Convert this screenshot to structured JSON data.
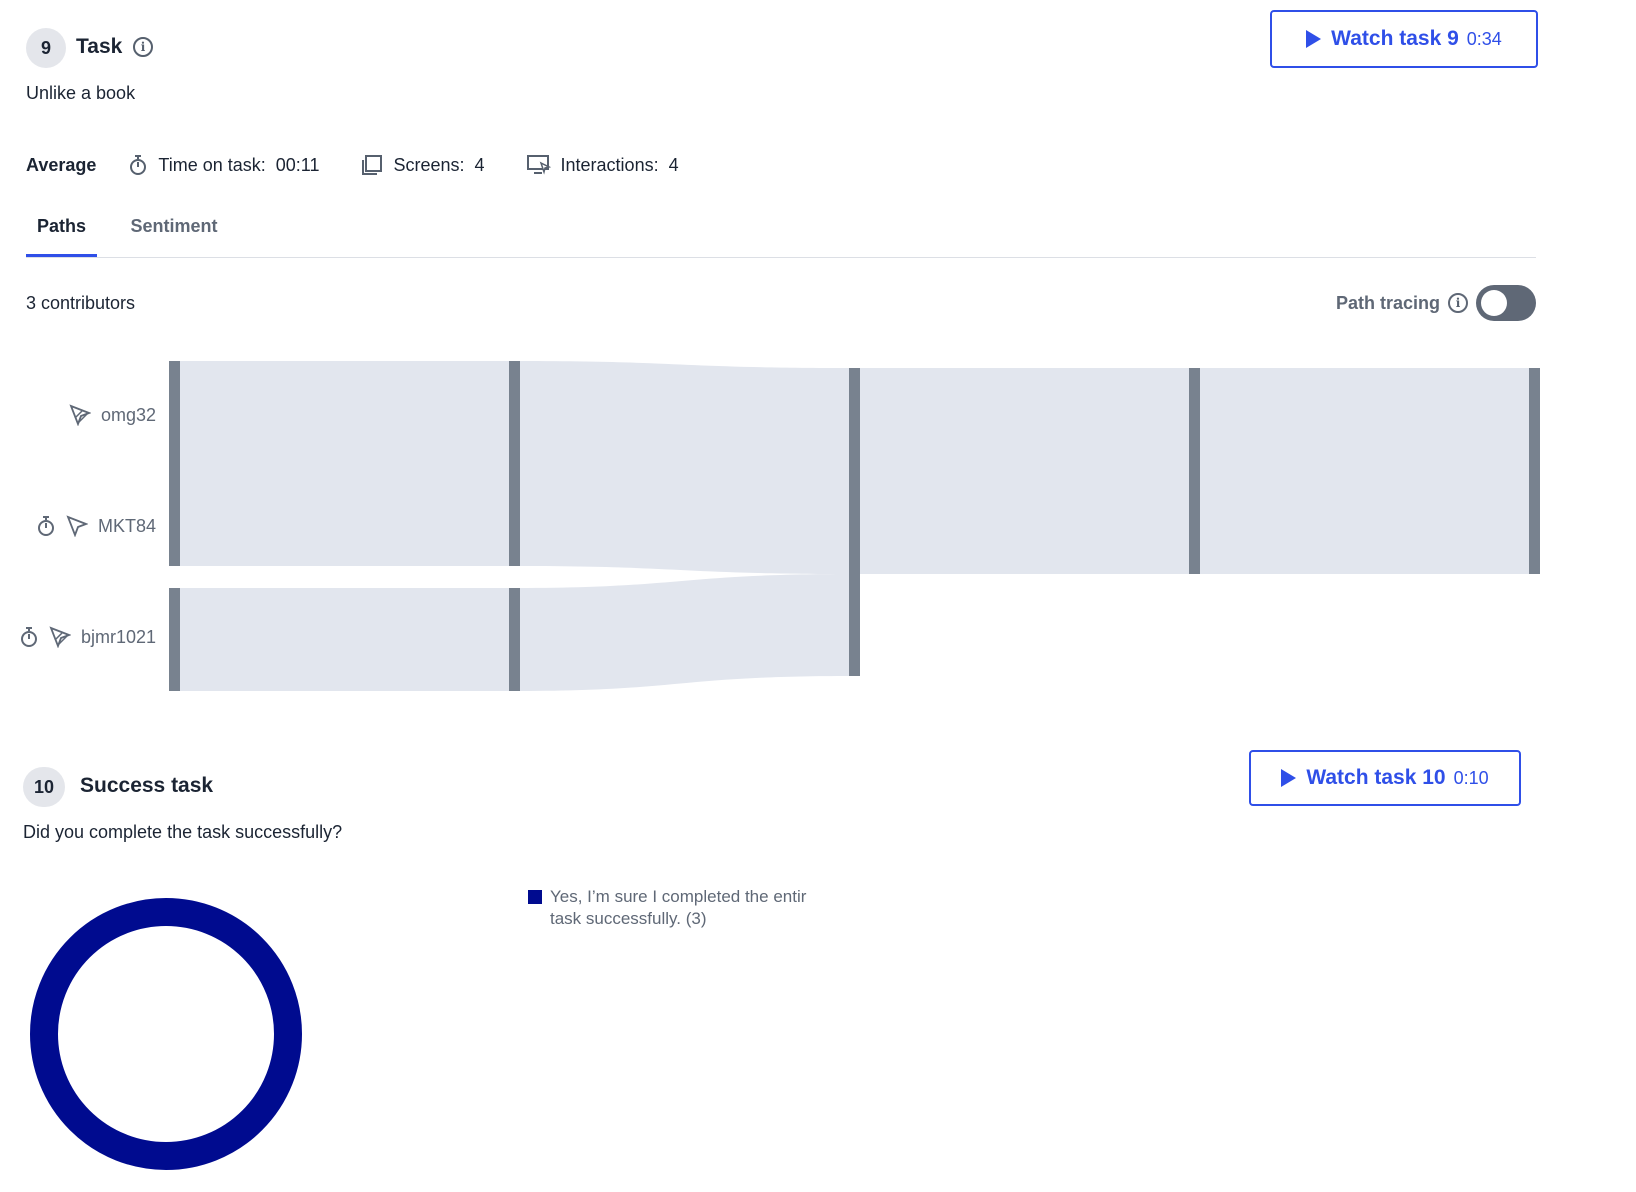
{
  "task9": {
    "number": "9",
    "title": "Task",
    "description": "Unlike a book",
    "watch_label": "Watch task 9",
    "watch_duration": "0:34"
  },
  "stats": {
    "average_label": "Average",
    "time_label": "Time on task:",
    "time_value": "00:11",
    "screens_label": "Screens:",
    "screens_value": "4",
    "interactions_label": "Interactions:",
    "interactions_value": "4"
  },
  "tabs": [
    {
      "label": "Paths",
      "active": true
    },
    {
      "label": "Sentiment",
      "active": false
    }
  ],
  "contributors_label": "3 contributors",
  "path_tracing": {
    "label": "Path tracing",
    "enabled": false
  },
  "participants": [
    {
      "name": "omg32",
      "icons": [
        "path-icon"
      ]
    },
    {
      "name": "MKT84",
      "icons": [
        "stopwatch-icon",
        "direct-path-icon"
      ]
    },
    {
      "name": "bjmr1021",
      "icons": [
        "stopwatch-icon",
        "path-icon"
      ]
    }
  ],
  "colors": {
    "accent": "#2f4fe8",
    "node": "#78828f",
    "flow": "#e2e6ee",
    "donut": "#000b8f"
  },
  "task10": {
    "number": "10",
    "title": "Success task",
    "question": "Did you complete the task successfully?",
    "watch_label": "Watch task 10",
    "watch_duration": "0:10"
  },
  "chart_data": {
    "type": "pie",
    "categories": [
      "Yes, I’m sure I completed the entir task successfully."
    ],
    "values": [
      3
    ],
    "legend": [
      "Yes, I’m sure I completed the entir task successfully. (3)"
    ],
    "legend_position": "right"
  }
}
